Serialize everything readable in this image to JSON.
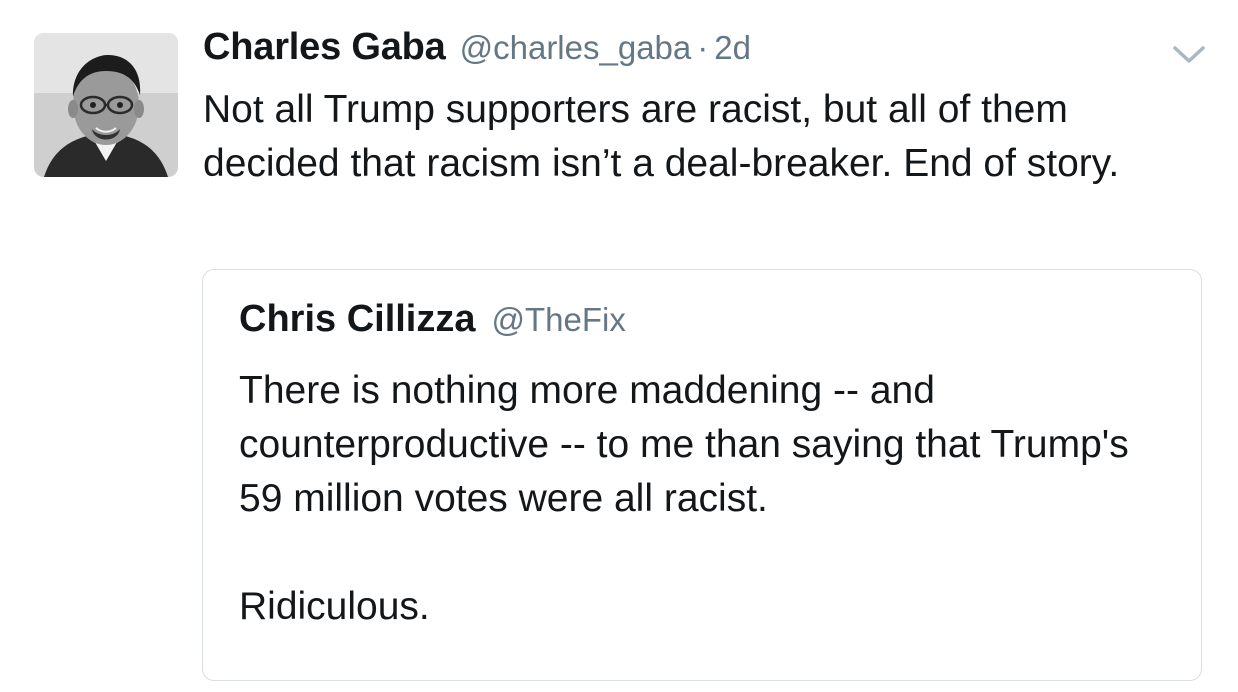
{
  "tweet": {
    "author_name": "Charles Gaba",
    "author_handle": "@charles_gaba",
    "separator": "·",
    "time": "2d",
    "text": "Not all Trump supporters are racist, but all of them decided that racism isn’t a deal-breaker. End of story."
  },
  "quoted_tweet": {
    "author_name": "Chris Cillizza",
    "author_handle": "@TheFix",
    "text": "There is nothing more maddening -- and counterproductive -- to me than saying that Trump's 59 million votes were all racist.\n\nRidiculous."
  },
  "icons": {
    "menu": "chevron-down-icon",
    "avatar": "avatar-photo"
  },
  "colors": {
    "text": "#14171a",
    "secondary": "#657786",
    "border": "#d9dee3"
  }
}
